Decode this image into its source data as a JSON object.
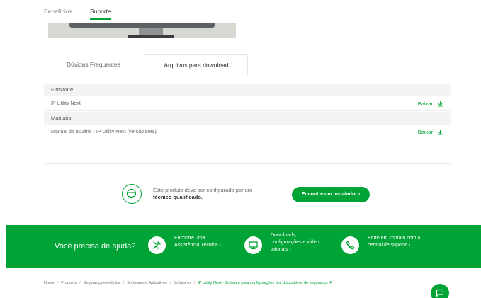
{
  "top_tabs": [
    {
      "label": "Benefícios"
    },
    {
      "label": "Suporte"
    }
  ],
  "support_tabs": [
    {
      "label": "Dúvidas Frequentes"
    },
    {
      "label": "Arquivos para download"
    }
  ],
  "downloads": {
    "groups": [
      {
        "title": "Firmware",
        "files": [
          {
            "name": "IP Utility Next",
            "action": "Baixar"
          }
        ]
      },
      {
        "title": "Manuais",
        "files": [
          {
            "name": "Manual do usuário - IP Utility Next (versão beta)",
            "action": "Baixar"
          }
        ]
      }
    ]
  },
  "installer": {
    "text_prefix": "Este produto deve ser configurado por um",
    "text_bold": "técnico qualificado.",
    "button_label": "Encontre um instalador ›"
  },
  "help": {
    "title": "Você precisa de ajuda?",
    "items": [
      {
        "line1": "Encontre uma",
        "line2": "Assistência Técnica ›",
        "icon": "tools-icon"
      },
      {
        "line1": "Downloads,",
        "line2": "configurações e vídeo",
        "line3": "tutoriais ›",
        "icon": "monitor-icon"
      },
      {
        "line1": "Entre em contato com a",
        "line2": "central de suporte ›",
        "icon": "phone-icon"
      }
    ]
  },
  "breadcrumb": {
    "items": [
      "Home",
      "Produtos",
      "Segurança eletrônica",
      "Softwares e Aplicativos",
      "Softwares"
    ],
    "current": "IP Utility Next - Software para configurações dos dispositivos de segurança IP",
    "separator": "/"
  },
  "colors": {
    "brand_green": "#00a335"
  }
}
